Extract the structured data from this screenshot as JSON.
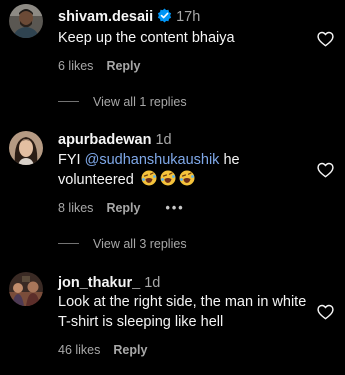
{
  "comments": [
    {
      "username": "shivam.desaii",
      "verified": true,
      "time": "17h",
      "text": "Keep up the content bhaiya",
      "likes": "6 likes",
      "reply": "Reply",
      "view_replies": "View all 1 replies"
    },
    {
      "username": "apurbadewan",
      "time": "1d",
      "text_prefix": "FYI ",
      "mention": "@sudhanshukaushik",
      "text_suffix": " he volunteered",
      "emojis": [
        "rolling-on-floor-laughing",
        "rolling-on-floor-laughing",
        "rolling-on-floor-laughing"
      ],
      "likes": "8 likes",
      "reply": "Reply",
      "more": "•••",
      "view_replies": "View all 3 replies"
    },
    {
      "username": "jon_thakur_",
      "time": "1d",
      "text": "Look at the right side, the man in white T-shirt is sleeping like hell",
      "likes": "46 likes",
      "reply": "Reply"
    }
  ],
  "icons": {
    "like": "heart-outline-icon",
    "verified": "verified-badge-icon"
  },
  "colors": {
    "background": "#000000",
    "text": "#f5f5f5",
    "secondary": "#a8a8a8",
    "mention": "#7fa8e8",
    "verified": "#0095f6"
  }
}
